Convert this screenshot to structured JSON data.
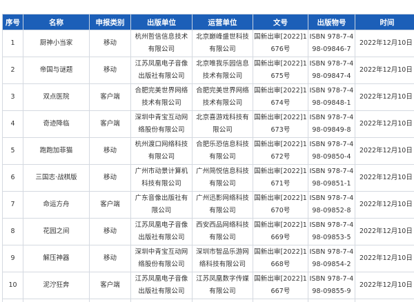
{
  "table": {
    "headers": [
      "序号",
      "名称",
      "申报类别",
      "出版单位",
      "运营单位",
      "文号",
      "出版物号",
      "时间"
    ],
    "rows": [
      {
        "no": "1",
        "name": "厨神小当家",
        "category": "移动",
        "publisher": "杭州哲信信息技术有限公司",
        "operator": "北京巅峰盛世科技有限公司",
        "approval": "国新出审[2022]1676号",
        "isbn": "ISBN 978-7-498-09846-7",
        "date": "2022年12月10日"
      },
      {
        "no": "2",
        "name": "帝国与谜题",
        "category": "移动",
        "publisher": "江苏凤凰电子音像出版社有限公司",
        "operator": "北京唯我乐园信息技术有限公司",
        "approval": "国新出审[2022]1675号",
        "isbn": "ISBN 978-7-498-09847-4",
        "date": "2022年12月10日"
      },
      {
        "no": "3",
        "name": "双点医院",
        "category": "客户端",
        "publisher": "合肥完美世界网络技术有限公司",
        "operator": "合肥完美世界网络技术有限公司",
        "approval": "国新出审[2022]1674号",
        "isbn": "ISBN 978-7-498-09848-1",
        "date": "2022年12月10日"
      },
      {
        "no": "4",
        "name": "奇迹降临",
        "category": "客户端",
        "publisher": "深圳中青宝互动网络股份有限公司",
        "operator": "北京喜游戏科技有限公司",
        "approval": "国新出审[2022]1673号",
        "isbn": "ISBN 978-7-498-09849-8",
        "date": "2022年12月10日"
      },
      {
        "no": "5",
        "name": "跑跑加菲猫",
        "category": "移动",
        "publisher": "杭州渡口网络科技有限公司",
        "operator": "合肥乐恐信息科技有限公司",
        "approval": "国新出审[2022]1672号",
        "isbn": "ISBN 978-7-498-09850-4",
        "date": "2022年12月10日"
      },
      {
        "no": "6",
        "name": "三国志·战棋版",
        "category": "移动",
        "publisher": "广州市动景计算机科技有限公司",
        "operator": "广州简悦信息科技有限公司",
        "approval": "国新出审[2022]1671号",
        "isbn": "ISBN 978-7-498-09851-1",
        "date": "2022年12月10日"
      },
      {
        "no": "7",
        "name": "命运方舟",
        "category": "客户端",
        "publisher": "广东音像出版社有限公司",
        "operator": "广州迅影网络科技有限公司",
        "approval": "国新出审[2022]1670号",
        "isbn": "ISBN 978-7-498-09852-8",
        "date": "2022年12月10日"
      },
      {
        "no": "8",
        "name": "花园之间",
        "category": "移动",
        "publisher": "江苏凤凰电子音像出版社有限公司",
        "operator": "西安西品网络科技有限公司",
        "approval": "国新出审[2022]1669号",
        "isbn": "ISBN 978-7-498-09853-5",
        "date": "2022年12月10日"
      },
      {
        "no": "9",
        "name": "解压神器",
        "category": "移动",
        "publisher": "深圳中青宝互动网络股份有限公司",
        "operator": "深圳市智品乐游网络科技有限公司",
        "approval": "国新出审[2022]1668号",
        "isbn": "ISBN 978-7-498-09854-2",
        "date": "2022年12月10日"
      },
      {
        "no": "10",
        "name": "泥泞狂奔",
        "category": "客户端",
        "publisher": "江苏凤凰电子音像出版社有限公司",
        "operator": "江苏凤凰数字传媒有限公司",
        "approval": "国新出审[2022]1667号",
        "isbn": "ISBN 978-7-498-09855-9",
        "date": "2022年12月10日"
      }
    ]
  }
}
